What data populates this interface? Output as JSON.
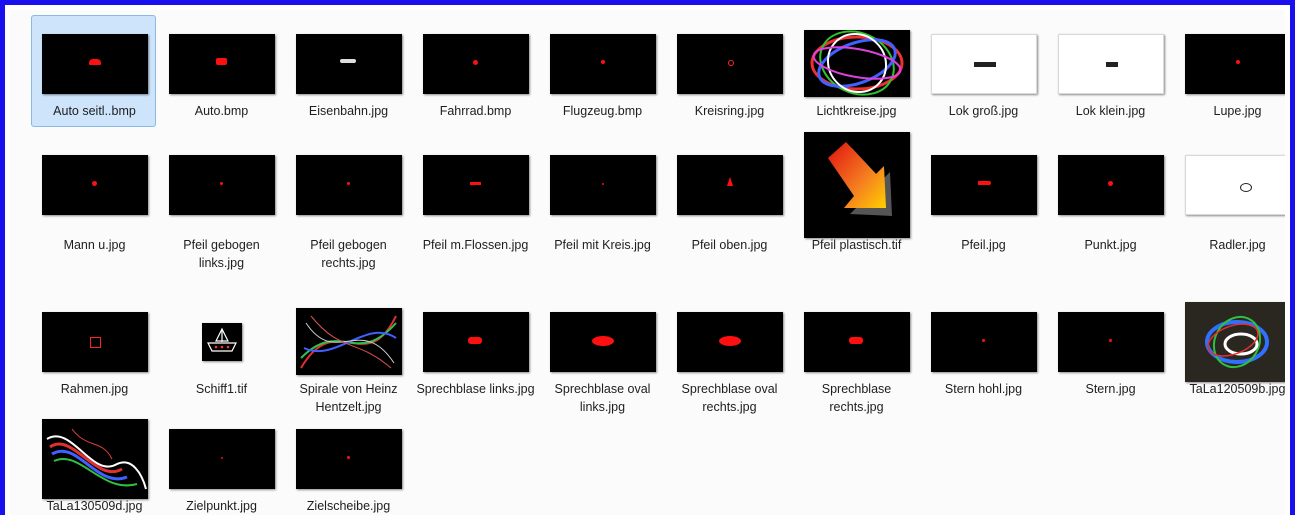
{
  "window": {
    "border_color": "#1a10ef",
    "background": "#fbfbfb",
    "selection_color": "#cde4fb"
  },
  "files": [
    {
      "name": "Auto seitl..bmp",
      "thumb": "black",
      "mark": "car-side",
      "selected": true
    },
    {
      "name": "Auto.bmp",
      "thumb": "black",
      "mark": "car"
    },
    {
      "name": "Eisenbahn.jpg",
      "thumb": "black",
      "mark": "train"
    },
    {
      "name": "Fahrrad.bmp",
      "thumb": "black",
      "mark": "bike"
    },
    {
      "name": "Flugzeug.bmp",
      "thumb": "black",
      "mark": "plane"
    },
    {
      "name": "Kreisring.jpg",
      "thumb": "black",
      "mark": "ring"
    },
    {
      "name": "Lichtkreise.jpg",
      "thumb": "light-rings",
      "mark": "none"
    },
    {
      "name": "Lok groß.jpg",
      "thumb": "white",
      "mark": "loco-big"
    },
    {
      "name": "Lok klein.jpg",
      "thumb": "white",
      "mark": "loco-small"
    },
    {
      "name": "Lupe.jpg",
      "thumb": "black",
      "mark": "magnifier"
    },
    {
      "name": "Mann u.jpg",
      "thumb": "black",
      "mark": "dot"
    },
    {
      "name": "Pfeil gebogen links.jpg",
      "thumb": "black",
      "mark": "dot-small"
    },
    {
      "name": "Pfeil gebogen rechts.jpg",
      "thumb": "black",
      "mark": "dot-small"
    },
    {
      "name": "Pfeil m.Flossen.jpg",
      "thumb": "black",
      "mark": "arrow-fins"
    },
    {
      "name": "Pfeil mit Kreis.jpg",
      "thumb": "black",
      "mark": "dot-tiny"
    },
    {
      "name": "Pfeil oben.jpg",
      "thumb": "black",
      "mark": "arrow-up"
    },
    {
      "name": "Pfeil plastisch.tif",
      "thumb": "arrow-3d",
      "mark": "none"
    },
    {
      "name": "Pfeil.jpg",
      "thumb": "black",
      "mark": "arrow"
    },
    {
      "name": "Punkt.jpg",
      "thumb": "black",
      "mark": "dot"
    },
    {
      "name": "Radler.jpg",
      "thumb": "white",
      "mark": "cyclist"
    },
    {
      "name": "Rahmen.jpg",
      "thumb": "black",
      "mark": "frame"
    },
    {
      "name": "Schiff1.tif",
      "thumb": "ship",
      "mark": "none"
    },
    {
      "name": "Spirale von Heinz Hentzelt.jpg",
      "thumb": "spiral",
      "mark": "none"
    },
    {
      "name": "Sprechblase links.jpg",
      "thumb": "black",
      "mark": "bubble"
    },
    {
      "name": "Sprechblase oval links.jpg",
      "thumb": "black",
      "mark": "oval"
    },
    {
      "name": "Sprechblase oval rechts.jpg",
      "thumb": "black",
      "mark": "oval"
    },
    {
      "name": "Sprechblase rechts.jpg",
      "thumb": "black",
      "mark": "bubble"
    },
    {
      "name": "Stern hohl.jpg",
      "thumb": "black",
      "mark": "dot-small"
    },
    {
      "name": "Stern.jpg",
      "thumb": "black",
      "mark": "dot-small"
    },
    {
      "name": "TaLa120509b.jpg",
      "thumb": "tala-b",
      "mark": "none"
    },
    {
      "name": "TaLa130509d.jpg",
      "thumb": "tala-d",
      "mark": "none"
    },
    {
      "name": "Zielpunkt.jpg",
      "thumb": "black",
      "mark": "dot-tiny"
    },
    {
      "name": "Zielscheibe.jpg",
      "thumb": "black",
      "mark": "dot-small"
    }
  ]
}
